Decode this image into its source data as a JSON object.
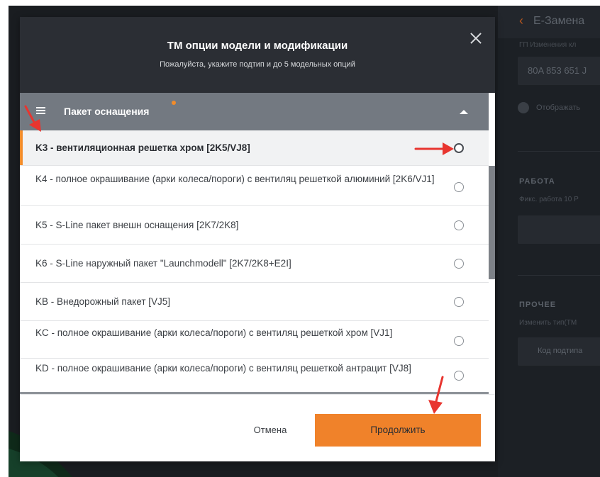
{
  "background": {
    "header_title": "E-Замена",
    "small_label": "ГП  Изменения кл",
    "field_value": "80A 853 651 J",
    "toggle_label": "Отображать",
    "section_work": "РАБОТА",
    "work_sub": "Фикс. работа 10 Р",
    "section_other": "ПРОЧЕЕ",
    "other_sub": "Изменить тип(ТМ",
    "subtype_button": "Код подтипа"
  },
  "modal": {
    "title": "ТМ опции модели и модификации",
    "subtitle": "Пожалуйста, укажите подтип и до 5 модельных опций",
    "group": {
      "title": "Пакет оснащения"
    },
    "items": [
      {
        "label": "K3 - вентиляционная решетка хром [2K5/VJ8]",
        "selected": true
      },
      {
        "label": "K4 - полное окрашивание (арки колеса/пороги) с вентиляц решеткой алюминий [2K6/VJ1]",
        "selected": false
      },
      {
        "label": "K5 - S-Line пакет внешн оснащения [2K7/2K8]",
        "selected": false
      },
      {
        "label": "K6 - S-Line наружный пакет \"Launchmodell\" [2K7/2K8+E2I]",
        "selected": false
      },
      {
        "label": "KB - Внедорожный пакет [VJ5]",
        "selected": false
      },
      {
        "label": "KC - полное окрашивание (арки колеса/пороги) с вентиляц решеткой хром [VJ1]",
        "selected": false
      },
      {
        "label": "KD - полное окрашивание (арки колеса/пороги) с вентиляц решеткой антрацит [VJ8]",
        "selected": false
      }
    ],
    "cancel_label": "Отмена",
    "continue_label": "Продолжить"
  },
  "colors": {
    "accent": "#f0822a",
    "header_bg": "#2b2e34",
    "group_bg": "#737981",
    "annotation_arrow": "#e8352f"
  }
}
